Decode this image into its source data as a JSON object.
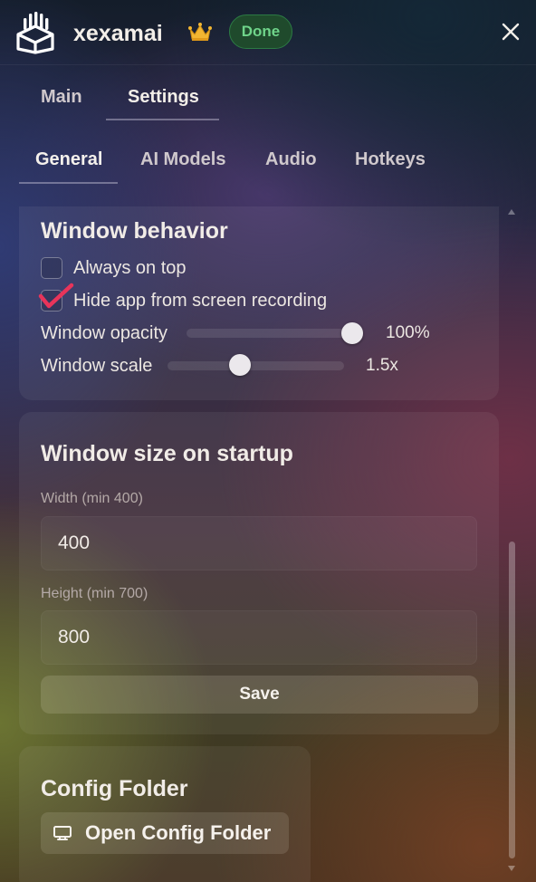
{
  "header": {
    "app_name": "xexamai",
    "status_badge": "Done",
    "logo_icon": "grid-box-logo-icon",
    "crown_icon": "crown-icon",
    "close_icon": "close-icon"
  },
  "main_tabs": [
    {
      "label": "Main",
      "active": false
    },
    {
      "label": "Settings",
      "active": true
    }
  ],
  "sub_tabs": [
    {
      "label": "General",
      "active": true
    },
    {
      "label": "AI Models",
      "active": false
    },
    {
      "label": "Audio",
      "active": false
    },
    {
      "label": "Hotkeys",
      "active": false
    }
  ],
  "window_behavior": {
    "title": "Window behavior",
    "always_on_top": {
      "label": "Always on top",
      "checked": false
    },
    "hide_from_recording": {
      "label": "Hide app from screen recording",
      "checked": true
    },
    "opacity": {
      "label": "Window opacity",
      "value_text": "100%",
      "level": 1.0
    },
    "scale": {
      "label": "Window scale",
      "value_text": "1.5x",
      "level": 0.4
    }
  },
  "window_size": {
    "title": "Window size on startup",
    "width_label": "Width (min 400)",
    "width_value": "400",
    "height_label": "Height (min 700)",
    "height_value": "800",
    "save_label": "Save"
  },
  "config_folder": {
    "title": "Config Folder",
    "open_label": "Open Config Folder",
    "open_icon": "folder-monitor-icon"
  },
  "colors": {
    "done_badge_bg": "#1f4a2c",
    "done_badge_text": "#6fd48a",
    "checkmark": "#e8345a",
    "crown": "#f2b632"
  }
}
